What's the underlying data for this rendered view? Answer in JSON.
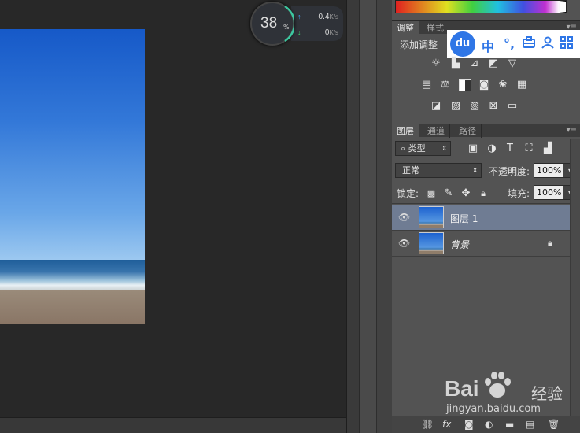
{
  "speed_widget": {
    "percent": "38",
    "percent_sign": "%",
    "upload": "0.4",
    "download": "0",
    "unit": "K/s"
  },
  "adjustments_panel": {
    "tabs": [
      "调整",
      "样式"
    ],
    "title": "添加调整",
    "menu_icon": "panel-menu-icon"
  },
  "baidu_toolbar": {
    "logo": "du",
    "items": [
      "中",
      "°,",
      "toolbox-icon",
      "user-icon",
      "grid-icon"
    ],
    "zh": "中",
    "punct": "°,"
  },
  "layers_panel": {
    "tabs": [
      "图层",
      "通道",
      "路径"
    ],
    "filter_kind": "类型",
    "blend_mode": "正常",
    "opacity_label": "不透明度:",
    "opacity_value": "100%",
    "lock_label": "锁定:",
    "fill_label": "填充:",
    "fill_value": "100%",
    "layers": [
      {
        "name": "图层 1",
        "selected": true,
        "visible": true,
        "locked": false
      },
      {
        "name": "背景",
        "selected": false,
        "visible": true,
        "locked": true
      }
    ]
  },
  "watermark": {
    "brand_a": "Bai",
    "brand_b": "经验",
    "url": "jingyan.baidu.com"
  },
  "colors": {
    "selected_layer": "#6f7c93",
    "panel_bg": "#535353",
    "canvas_bg": "#282828",
    "baidu_blue": "#2f76e6"
  }
}
